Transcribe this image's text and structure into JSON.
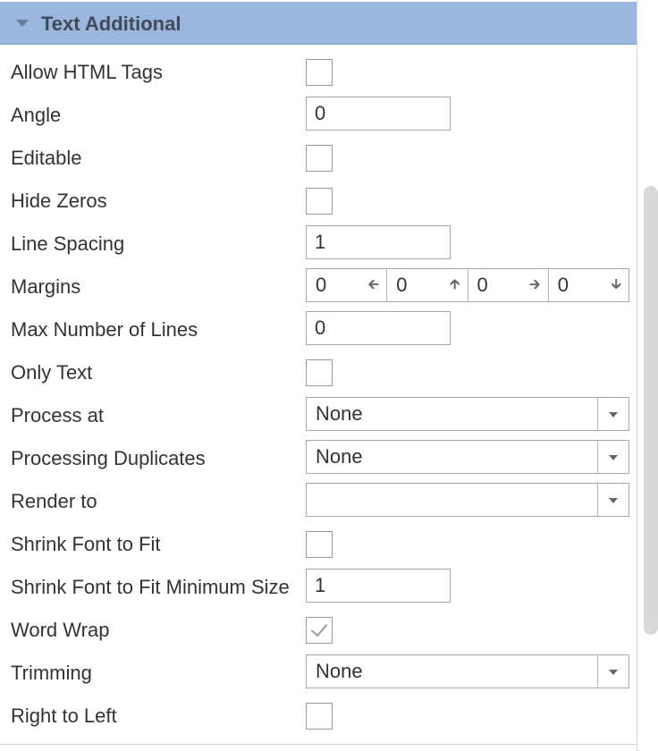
{
  "section": {
    "title": "Text Additional"
  },
  "properties": {
    "allow_html_tags": {
      "label": "Allow HTML Tags",
      "checked": false
    },
    "angle": {
      "label": "Angle",
      "value": "0"
    },
    "editable": {
      "label": "Editable",
      "checked": false
    },
    "hide_zeros": {
      "label": "Hide Zeros",
      "checked": false
    },
    "line_spacing": {
      "label": "Line Spacing",
      "value": "1"
    },
    "margins": {
      "label": "Margins",
      "left": "0",
      "top": "0",
      "right": "0",
      "bottom": "0"
    },
    "max_number_of_lines": {
      "label": "Max Number of Lines",
      "value": "0"
    },
    "only_text": {
      "label": "Only Text",
      "checked": false
    },
    "process_at": {
      "label": "Process at",
      "value": "None"
    },
    "processing_duplicates": {
      "label": "Processing Duplicates",
      "value": "None"
    },
    "render_to": {
      "label": "Render to",
      "value": ""
    },
    "shrink_font_to_fit": {
      "label": "Shrink Font to Fit",
      "checked": false
    },
    "shrink_font_min_size": {
      "label": "Shrink Font to Fit Minimum Size",
      "value": "1"
    },
    "word_wrap": {
      "label": "Word Wrap",
      "checked": true
    },
    "trimming": {
      "label": "Trimming",
      "value": "None"
    },
    "right_to_left": {
      "label": "Right to Left",
      "checked": false
    }
  },
  "icons": {
    "collapse": "triangle-down-icon",
    "margin_left": "arrow-left-icon",
    "margin_top": "arrow-up-icon",
    "margin_right": "arrow-right-icon",
    "margin_bottom": "arrow-down-icon",
    "dropdown": "chevron-down-icon"
  },
  "colors": {
    "header_bg": "#9ab6dd",
    "header_text": "#3f4a5a"
  }
}
